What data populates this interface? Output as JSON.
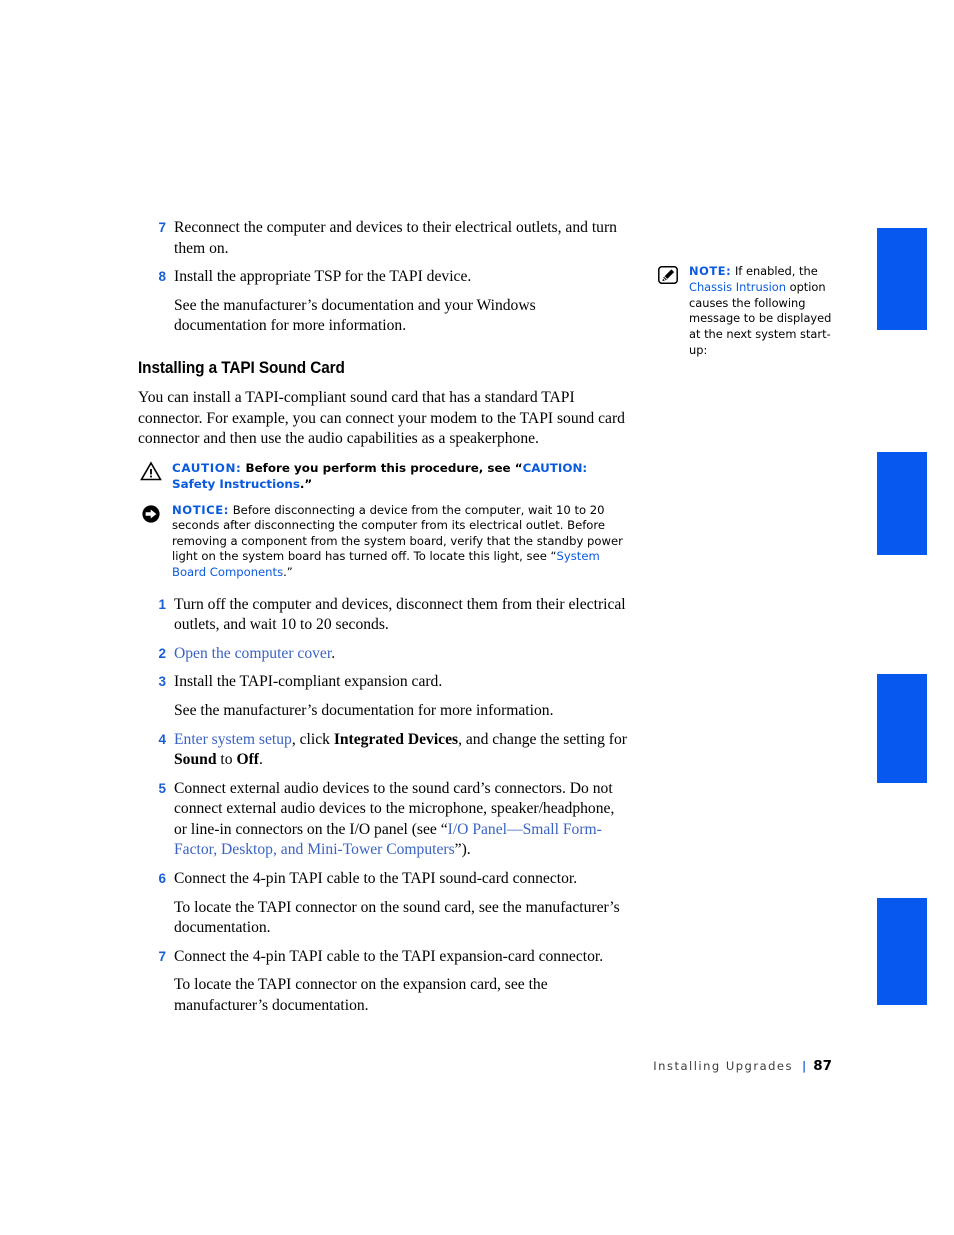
{
  "footer": {
    "chapter": "Installing Upgrades",
    "separator": "|",
    "page_number": "87"
  },
  "colors": {
    "tab_blue": "#0658EE",
    "link_serif_blue": "#3A63C4",
    "label_blue": "#0A5AE0",
    "step_number_blue": "#1A5FD8"
  },
  "tab_markers": [
    {
      "name": "tab-marker-1"
    },
    {
      "name": "tab-marker-2"
    },
    {
      "name": "tab-marker-3"
    },
    {
      "name": "tab-marker-4"
    }
  ],
  "top_steps": [
    {
      "number": "7",
      "text": "Reconnect the computer and devices to their electrical outlets, and turn them on."
    },
    {
      "number": "8",
      "text": "Install the appropriate TSP for the TAPI device."
    }
  ],
  "top_continuation": "See the manufacturer’s documentation and your Windows documentation for more information.",
  "section": {
    "heading": "Installing a TAPI Sound Card",
    "intro": "You can install a TAPI-compliant sound card that has a standard TAPI connector. For example, you can connect your modem to the TAPI sound card connector and then use the audio capabilities as a speakerphone."
  },
  "caution": {
    "icon": "warning-triangle-icon",
    "label": "CAUTION:",
    "text_before": " Before you perform this procedure, see “",
    "link": "CAUTION: Safety Instructions",
    "text_after": ".”"
  },
  "notice": {
    "icon": "notice-arrow-icon",
    "label": "NOTICE:",
    "text_before": " Before disconnecting a device from the computer, wait 10 to 20 seconds after disconnecting the computer from its electrical outlet. Before removing a component from the system board, verify that the standby power light on the system board has turned off. To locate this light, see “",
    "link": "System Board Components",
    "text_after": ".”"
  },
  "margin_note": {
    "icon": "pencil-note-icon",
    "label": "NOTE:",
    "text_before": " If enabled, the ",
    "link": "Chassis Intrusion",
    "text_after": " option causes the following message to be displayed at the next system start-up:"
  },
  "procedure": {
    "step1": {
      "number": "1",
      "text": "Turn off the computer and devices, disconnect them from their electrical outlets, and wait 10 to 20 seconds."
    },
    "step2": {
      "number": "2",
      "link": "Open the computer cover",
      "text_after": "."
    },
    "step3": {
      "number": "3",
      "text": "Install the TAPI-compliant expansion card.",
      "continuation": "See the manufacturer’s documentation for more information."
    },
    "step4": {
      "number": "4",
      "link": "Enter system setup",
      "text_mid1": ", click ",
      "bold1": "Integrated Devices",
      "text_mid2": ", and change the setting for ",
      "bold2": "Sound",
      "text_mid3": " to ",
      "bold3": "Off",
      "text_after": "."
    },
    "step5": {
      "number": "5",
      "text_before": "Connect external audio devices to the sound card’s connectors. Do not connect external audio devices to the microphone, speaker/headphone, or line-in connectors on the I/O panel (see “",
      "link": "I/O Panel—Small Form-Factor, Desktop, and Mini-Tower Computers",
      "text_after": "”)."
    },
    "step6": {
      "number": "6",
      "text": "Connect the 4-pin TAPI cable to the TAPI sound-card connector.",
      "continuation": "To locate the TAPI connector on the sound card, see the manufacturer’s documentation."
    },
    "step7": {
      "number": "7",
      "text": "Connect the 4-pin TAPI cable to the TAPI expansion-card connector.",
      "continuation": "To locate the TAPI connector on the expansion card, see the manufacturer’s documentation."
    }
  }
}
